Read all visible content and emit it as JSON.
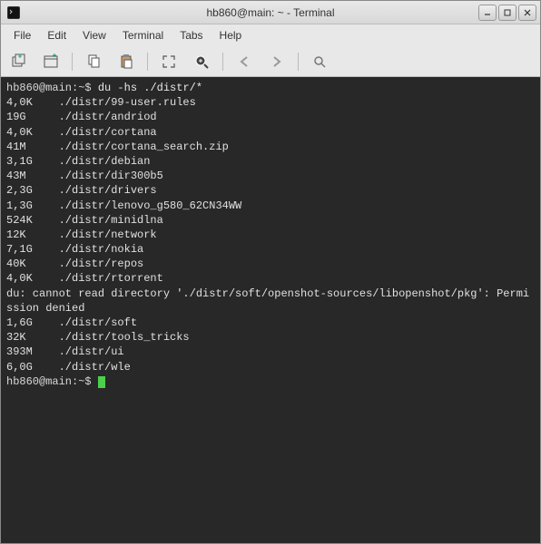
{
  "window": {
    "title": "hb860@main: ~ - Terminal"
  },
  "menu": {
    "file": "File",
    "edit": "Edit",
    "view": "View",
    "terminal": "Terminal",
    "tabs": "Tabs",
    "help": "Help"
  },
  "terminal": {
    "prompt_user": "hb860@main",
    "prompt_path": "~",
    "prompt_dollar": "$",
    "command": "du -hs ./distr/*",
    "lines": [
      {
        "size": "4,0K",
        "path": "./distr/99-user.rules"
      },
      {
        "size": "19G",
        "path": "./distr/andriod"
      },
      {
        "size": "4,0K",
        "path": "./distr/cortana"
      },
      {
        "size": "41M",
        "path": "./distr/cortana_search.zip"
      },
      {
        "size": "3,1G",
        "path": "./distr/debian"
      },
      {
        "size": "43M",
        "path": "./distr/dir300b5"
      },
      {
        "size": "2,3G",
        "path": "./distr/drivers"
      },
      {
        "size": "1,3G",
        "path": "./distr/lenovo_g580_62CN34WW"
      },
      {
        "size": "524K",
        "path": "./distr/minidlna"
      },
      {
        "size": "12K",
        "path": "./distr/network"
      },
      {
        "size": "7,1G",
        "path": "./distr/nokia"
      },
      {
        "size": "40K",
        "path": "./distr/repos"
      },
      {
        "size": "4,0K",
        "path": "./distr/rtorrent"
      }
    ],
    "error": "du: cannot read directory './distr/soft/openshot-sources/libopenshot/pkg': Permi\nssion denied",
    "lines2": [
      {
        "size": "1,6G",
        "path": "./distr/soft"
      },
      {
        "size": "32K",
        "path": "./distr/tools_tricks"
      },
      {
        "size": "393M",
        "path": "./distr/ui"
      },
      {
        "size": "6,0G",
        "path": "./distr/wle"
      }
    ]
  }
}
